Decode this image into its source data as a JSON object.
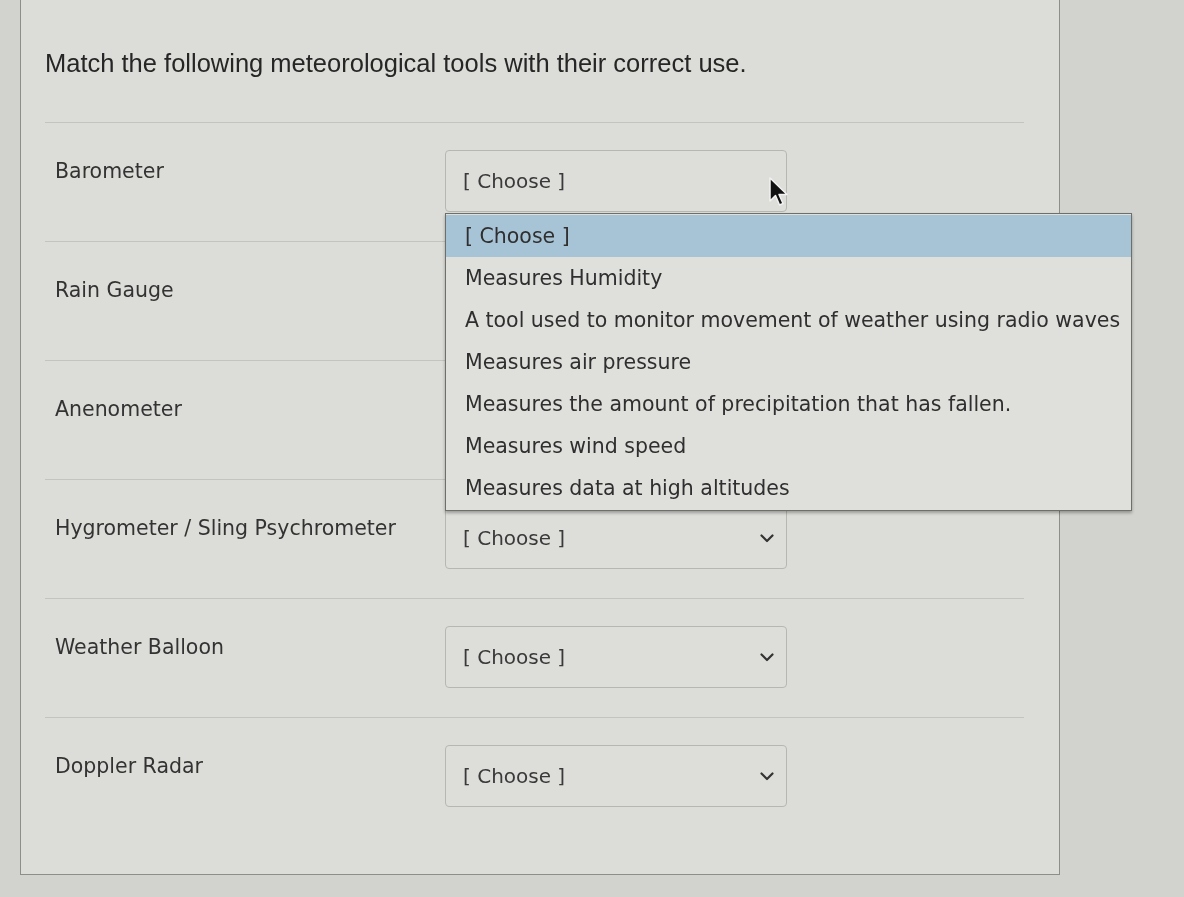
{
  "question": {
    "text": "Match the following meteorological tools with their correct use."
  },
  "rows": [
    {
      "label": "Barometer",
      "select": {
        "value": "[ Choose ]",
        "expanded": true,
        "options": [
          {
            "label": "[ Choose ]",
            "selected": true
          },
          {
            "label": "Measures Humidity",
            "selected": false
          },
          {
            "label": "A tool used to monitor movement of weather using radio waves",
            "selected": false
          },
          {
            "label": "Measures air pressure",
            "selected": false
          },
          {
            "label": "Measures the amount of precipitation that has fallen.",
            "selected": false
          },
          {
            "label": "Measures wind speed",
            "selected": false
          },
          {
            "label": "Measures data at high altitudes",
            "selected": false
          }
        ]
      }
    },
    {
      "label": "Rain Gauge"
    },
    {
      "label": "Anenometer"
    },
    {
      "label": "Hygrometer / Sling Psychrometer",
      "select": {
        "value": "[ Choose ]",
        "expanded": false
      }
    },
    {
      "label": "Weather Balloon",
      "select": {
        "value": "[ Choose ]",
        "expanded": false
      }
    },
    {
      "label": "Doppler Radar",
      "select": {
        "value": "[ Choose ]",
        "expanded": false
      }
    }
  ]
}
